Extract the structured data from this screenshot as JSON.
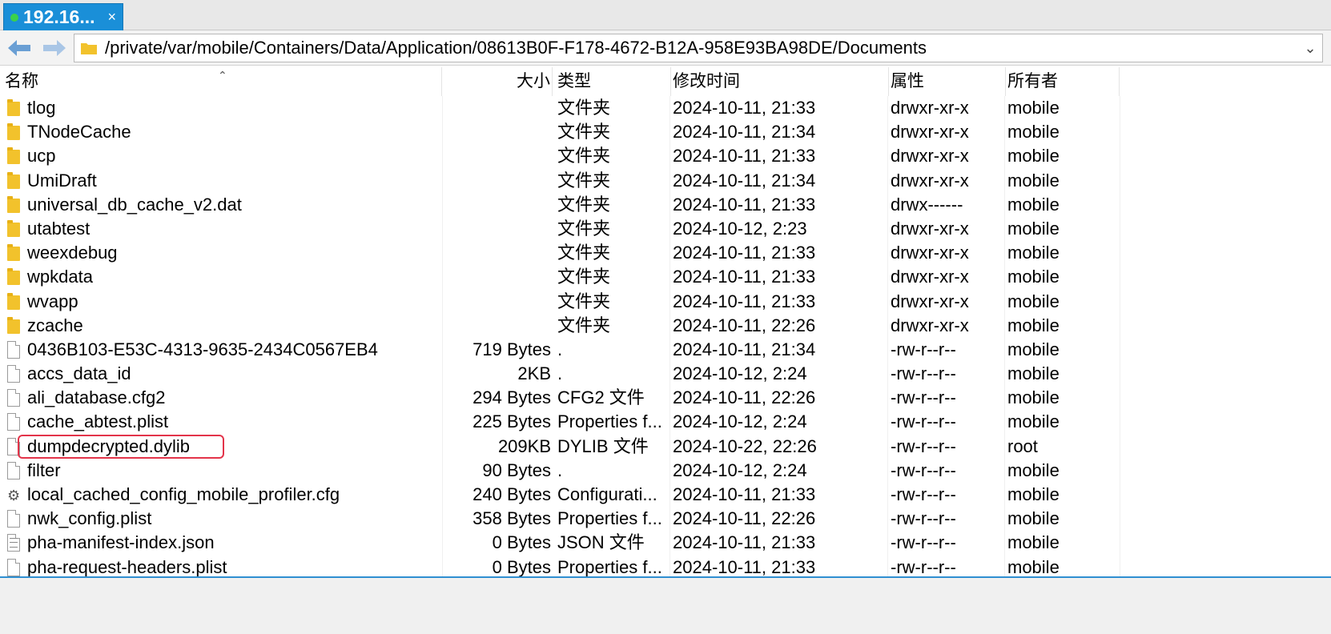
{
  "tab": {
    "title": "192.16...",
    "close": "×"
  },
  "toolbar": {
    "path": "/private/var/mobile/Containers/Data/Application/08613B0F-F178-4672-B12A-958E93BA98DE/Documents"
  },
  "columns": {
    "name": "名称",
    "size": "大小",
    "type": "类型",
    "modified": "修改时间",
    "attributes": "属性",
    "owner": "所有者"
  },
  "files": [
    {
      "icon": "folder-icon",
      "name": "tlog",
      "size": "",
      "type": "文件夹",
      "modified": "2024-10-11, 21:33",
      "attributes": "drwxr-xr-x",
      "owner": "mobile"
    },
    {
      "icon": "folder-icon",
      "name": "TNodeCache",
      "size": "",
      "type": "文件夹",
      "modified": "2024-10-11, 21:34",
      "attributes": "drwxr-xr-x",
      "owner": "mobile"
    },
    {
      "icon": "folder-icon",
      "name": "ucp",
      "size": "",
      "type": "文件夹",
      "modified": "2024-10-11, 21:33",
      "attributes": "drwxr-xr-x",
      "owner": "mobile"
    },
    {
      "icon": "folder-icon",
      "name": "UmiDraft",
      "size": "",
      "type": "文件夹",
      "modified": "2024-10-11, 21:34",
      "attributes": "drwxr-xr-x",
      "owner": "mobile"
    },
    {
      "icon": "folder-icon",
      "name": "universal_db_cache_v2.dat",
      "size": "",
      "type": "文件夹",
      "modified": "2024-10-11, 21:33",
      "attributes": "drwx------",
      "owner": "mobile"
    },
    {
      "icon": "folder-icon",
      "name": "utabtest",
      "size": "",
      "type": "文件夹",
      "modified": "2024-10-12, 2:23",
      "attributes": "drwxr-xr-x",
      "owner": "mobile"
    },
    {
      "icon": "folder-icon",
      "name": "weexdebug",
      "size": "",
      "type": "文件夹",
      "modified": "2024-10-11, 21:33",
      "attributes": "drwxr-xr-x",
      "owner": "mobile"
    },
    {
      "icon": "folder-icon",
      "name": "wpkdata",
      "size": "",
      "type": "文件夹",
      "modified": "2024-10-11, 21:33",
      "attributes": "drwxr-xr-x",
      "owner": "mobile"
    },
    {
      "icon": "folder-icon",
      "name": "wvapp",
      "size": "",
      "type": "文件夹",
      "modified": "2024-10-11, 21:33",
      "attributes": "drwxr-xr-x",
      "owner": "mobile"
    },
    {
      "icon": "folder-icon",
      "name": "zcache",
      "size": "",
      "type": "文件夹",
      "modified": "2024-10-11, 22:26",
      "attributes": "drwxr-xr-x",
      "owner": "mobile"
    },
    {
      "icon": "file-icon",
      "name": "0436B103-E53C-4313-9635-2434C0567EB4",
      "size": "719 Bytes",
      "type": ".",
      "modified": "2024-10-11, 21:34",
      "attributes": "-rw-r--r--",
      "owner": "mobile"
    },
    {
      "icon": "file-icon",
      "name": "accs_data_id",
      "size": "2KB",
      "type": ".",
      "modified": "2024-10-12, 2:24",
      "attributes": "-rw-r--r--",
      "owner": "mobile"
    },
    {
      "icon": "file-icon",
      "name": "ali_database.cfg2",
      "size": "294 Bytes",
      "type": "CFG2 文件",
      "modified": "2024-10-11, 22:26",
      "attributes": "-rw-r--r--",
      "owner": "mobile"
    },
    {
      "icon": "file-icon",
      "name": "cache_abtest.plist",
      "size": "225 Bytes",
      "type": "Properties f...",
      "modified": "2024-10-12, 2:24",
      "attributes": "-rw-r--r--",
      "owner": "mobile"
    },
    {
      "icon": "file-icon",
      "name": "dumpdecrypted.dylib",
      "size": "209KB",
      "type": "DYLIB 文件",
      "modified": "2024-10-22, 22:26",
      "attributes": "-rw-r--r--",
      "owner": "root"
    },
    {
      "icon": "file-icon",
      "name": "filter",
      "size": "90 Bytes",
      "type": ".",
      "modified": "2024-10-12, 2:24",
      "attributes": "-rw-r--r--",
      "owner": "mobile"
    },
    {
      "icon": "gear-icon",
      "name": "local_cached_config_mobile_profiler.cfg",
      "size": "240 Bytes",
      "type": "Configurati...",
      "modified": "2024-10-11, 21:33",
      "attributes": "-rw-r--r--",
      "owner": "mobile"
    },
    {
      "icon": "file-icon",
      "name": "nwk_config.plist",
      "size": "358 Bytes",
      "type": "Properties f...",
      "modified": "2024-10-11, 22:26",
      "attributes": "-rw-r--r--",
      "owner": "mobile"
    },
    {
      "icon": "text-file-icon",
      "name": "pha-manifest-index.json",
      "size": "0 Bytes",
      "type": "JSON 文件",
      "modified": "2024-10-11, 21:33",
      "attributes": "-rw-r--r--",
      "owner": "mobile"
    },
    {
      "icon": "file-icon",
      "name": "pha-request-headers.plist",
      "size": "0 Bytes",
      "type": "Properties f...",
      "modified": "2024-10-11, 21:33",
      "attributes": "-rw-r--r--",
      "owner": "mobile"
    }
  ],
  "colors": {
    "tab_accent": "#1a8fd8",
    "highlight_border": "#e3344a",
    "folder": "#f2c22c"
  }
}
